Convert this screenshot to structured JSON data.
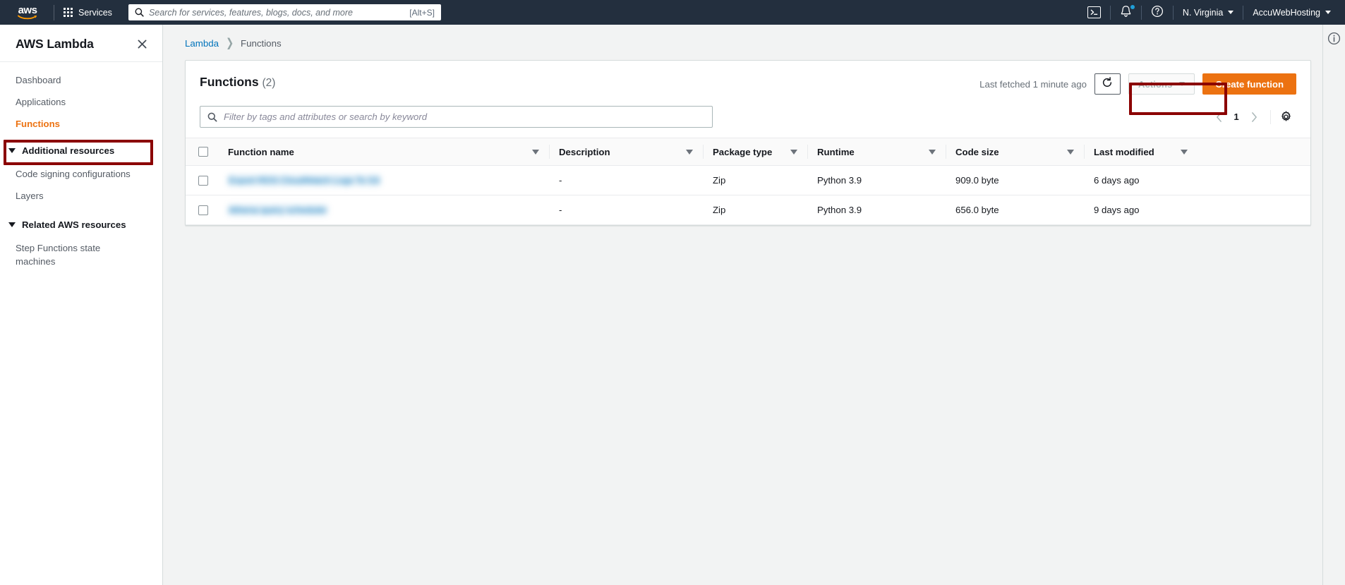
{
  "topnav": {
    "logo_text": "aws",
    "services_label": "Services",
    "search": {
      "placeholder": "Search for services, features, blogs, docs, and more",
      "value": "",
      "shortcut": "[Alt+S]"
    },
    "cloudshell_label": "",
    "region_label": "N. Virginia",
    "account_label": "AccuWebHosting"
  },
  "sidebar": {
    "title": "AWS Lambda",
    "items": [
      {
        "label": "Dashboard",
        "active": false
      },
      {
        "label": "Applications",
        "active": false
      },
      {
        "label": "Functions",
        "active": true
      }
    ],
    "groups": [
      {
        "label": "Additional resources",
        "items": [
          {
            "label": "Code signing configurations"
          },
          {
            "label": "Layers"
          }
        ]
      },
      {
        "label": "Related AWS resources",
        "items": [
          {
            "label": "Step Functions state machines"
          }
        ]
      }
    ]
  },
  "breadcrumb": {
    "root": "Lambda",
    "current": "Functions"
  },
  "panel": {
    "title": "Functions",
    "count": "(2)",
    "last_fetched": "Last fetched 1 minute ago",
    "actions_label": "Actions",
    "create_label": "Create function",
    "filter_placeholder": "Filter by tags and attributes or search by keyword",
    "filter_value": "",
    "page_number": "1"
  },
  "table": {
    "columns": [
      "Function name",
      "Description",
      "Package type",
      "Runtime",
      "Code size",
      "Last modified"
    ],
    "rows": [
      {
        "name": "Export RDS CloudWatch Logs To S3",
        "description": "-",
        "package_type": "Zip",
        "runtime": "Python 3.9",
        "code_size": "909.0 byte",
        "last_modified": "6 days ago"
      },
      {
        "name": "Athena query scheduler",
        "description": "-",
        "package_type": "Zip",
        "runtime": "Python 3.9",
        "code_size": "656.0 byte",
        "last_modified": "9 days ago"
      }
    ]
  },
  "annotations": {
    "color": "#8b0000",
    "targets": [
      "sidebar-item-functions",
      "create-function-button"
    ]
  }
}
